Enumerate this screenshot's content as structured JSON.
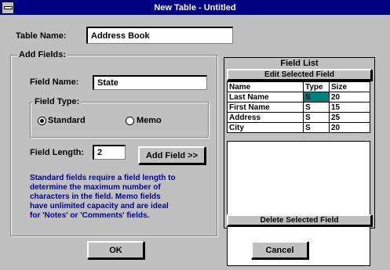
{
  "window": {
    "title": "New Table - Untitled"
  },
  "table_name": {
    "label": "Table Name:",
    "value": "Address Book"
  },
  "add_fields": {
    "title": "Add Fields:",
    "field_name": {
      "label": "Field Name:",
      "value": "State"
    },
    "field_type": {
      "title": "Field Type:",
      "standard_label": "Standard",
      "memo_label": "Memo",
      "selected": "Standard"
    },
    "field_length": {
      "label": "Field Length:",
      "value": "2"
    },
    "add_button": "Add Field >>",
    "help_text": [
      "Standard fields require a field length to",
      "determine the maximum number of",
      "characters in the field.  Memo fields",
      "have unlimited capacity and are ideal",
      "for 'Notes' or 'Comments' fields."
    ]
  },
  "field_list": {
    "title": "Field List",
    "edit_button": "Edit Selected Field",
    "columns": [
      "Name",
      "Type",
      "Size"
    ],
    "rows": [
      {
        "name": "Last Name",
        "type": "S",
        "size": "20"
      },
      {
        "name": "First Name",
        "type": "S",
        "size": "15"
      },
      {
        "name": "Address",
        "type": "S",
        "size": "25"
      },
      {
        "name": "City",
        "type": "S",
        "size": "20"
      }
    ],
    "delete_button": "Delete Selected Field",
    "highlight_color": "#008080"
  },
  "buttons": {
    "ok": "OK",
    "cancel": "Cancel"
  }
}
